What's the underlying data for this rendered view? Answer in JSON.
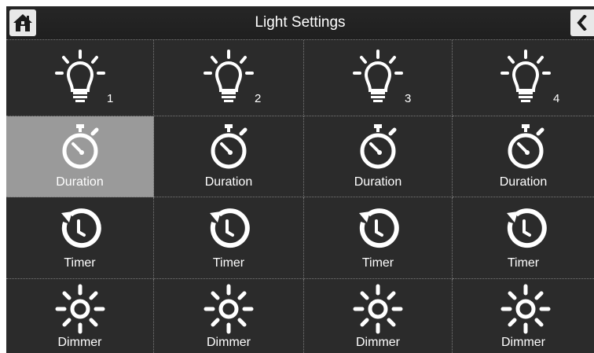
{
  "header": {
    "title": "Light Settings",
    "home_icon": "home-icon",
    "back_icon": "chevron-left-icon"
  },
  "lights": [
    {
      "number": "1"
    },
    {
      "number": "2"
    },
    {
      "number": "3"
    },
    {
      "number": "4"
    }
  ],
  "rows": {
    "duration": [
      "Duration",
      "Duration",
      "Duration",
      "Duration"
    ],
    "timer": [
      "Timer",
      "Timer",
      "Timer",
      "Timer"
    ],
    "dimmer": [
      "Dimmer",
      "Dimmer",
      "Dimmer",
      "Dimmer"
    ]
  },
  "selected_cell": "duration-1",
  "colors": {
    "background": "#2b2b2b",
    "selected": "#9a9a9a",
    "text": "#ffffff"
  }
}
